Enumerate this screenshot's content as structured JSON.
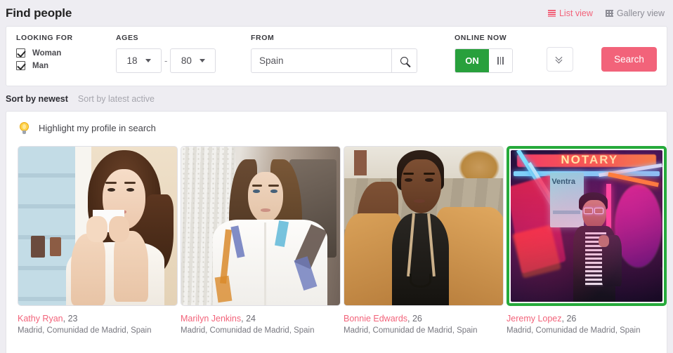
{
  "header": {
    "title": "Find people",
    "views": [
      {
        "label": "List view",
        "icon": "list-icon",
        "active": true
      },
      {
        "label": "Gallery view",
        "icon": "grid-icon",
        "active": false
      }
    ]
  },
  "filters": {
    "looking_for": {
      "label": "LOOKING FOR",
      "options": [
        {
          "label": "Woman",
          "checked": true
        },
        {
          "label": "Man",
          "checked": true
        }
      ]
    },
    "ages": {
      "label": "AGES",
      "min": "18",
      "max": "80",
      "separator": "-"
    },
    "from": {
      "label": "FROM",
      "value": "Spain",
      "placeholder": "Spain",
      "search_icon": "magnifier-icon"
    },
    "online_now": {
      "label": "ONLINE NOW",
      "state": "ON",
      "on_color": "#28a03c"
    },
    "more_options_icon": "double-chevron-down-icon",
    "search_button": {
      "label": "Search",
      "color": "#f2637a"
    }
  },
  "sort": {
    "options": [
      {
        "label": "Sort by newest",
        "active": true
      },
      {
        "label": "Sort by latest active",
        "active": false
      }
    ]
  },
  "results": {
    "highlight": {
      "icon": "lightbulb-icon",
      "label": "Highlight my profile in search"
    },
    "name_color": "#f2637a",
    "online_border_color": "#26aa3b",
    "profiles": [
      {
        "name": "Kathy Ryan",
        "age": "23",
        "location": "Madrid, Comunidad de Madrid, Spain",
        "online": false,
        "photo": "p1"
      },
      {
        "name": "Marilyn Jenkins",
        "age": "24",
        "location": "Madrid, Comunidad de Madrid, Spain",
        "online": false,
        "photo": "p2"
      },
      {
        "name": "Bonnie Edwards",
        "age": "26",
        "location": "Madrid, Comunidad de Madrid, Spain",
        "online": false,
        "photo": "p3"
      },
      {
        "name": "Jeremy Lopez",
        "age": "26",
        "location": "Madrid, Comunidad de Madrid, Spain",
        "online": true,
        "photo": "p4",
        "neon_text": "NOTARY",
        "poster_text": "Ventra"
      }
    ]
  }
}
